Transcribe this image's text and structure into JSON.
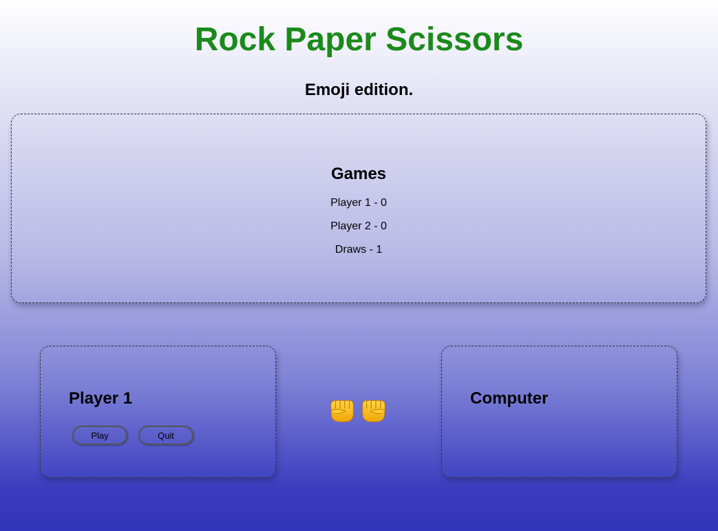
{
  "header": {
    "title": "Rock Paper Scissors",
    "subtitle": "Emoji edition."
  },
  "scoreboard": {
    "title": "Games",
    "player1": "Player 1 - 0",
    "player2": "Player 2 - 0",
    "draws": "Draws - 1"
  },
  "player_card": {
    "title": "Player 1",
    "play_label": "Play",
    "quit_label": "Quit"
  },
  "computer_card": {
    "title": "Computer"
  },
  "center": {
    "icons": [
      "fist-emoji",
      "fist-emoji"
    ]
  },
  "colors": {
    "title": "#1b8a1b",
    "background_top": "#ffffff",
    "background_bottom": "#3034b8"
  }
}
